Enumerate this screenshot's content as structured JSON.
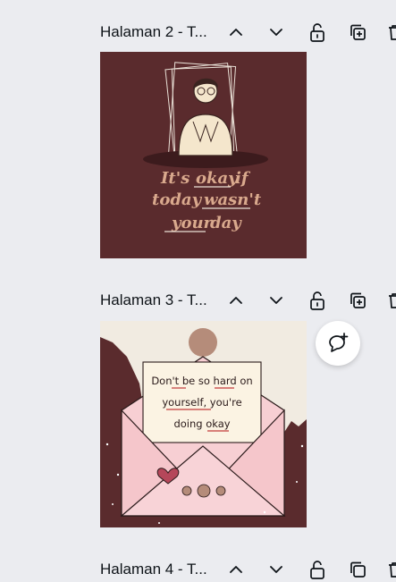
{
  "pages": [
    {
      "title": "Halaman 2 - T...",
      "design": {
        "quote_line1_a": "It's",
        "quote_line1_b": "okay",
        "quote_line1_c": "if",
        "quote_line2_a": "today",
        "quote_line2_b": "wasn't",
        "quote_line3_a": "your",
        "quote_line3_b": "day"
      }
    },
    {
      "title": "Halaman 3 - T...",
      "design": {
        "letter_line1": "Don't be so hard on",
        "letter_line2": "yourself, you're",
        "letter_line3": "doing okay"
      }
    },
    {
      "title": "Halaman 4 - T..."
    }
  ],
  "icons": {
    "move_up": "chevron-up-icon",
    "move_down": "chevron-down-icon",
    "lock": "unlock-icon",
    "duplicate": "duplicate-icon",
    "delete": "trash-icon",
    "comment": "add-comment-icon"
  },
  "colors": {
    "canvas_bg": "#ebecf0",
    "page2_bg": "#5a2b2d",
    "page3_paper": "#f1ebe1",
    "envelope": "#f7cfd3",
    "quote_text": "#d9a98d"
  }
}
